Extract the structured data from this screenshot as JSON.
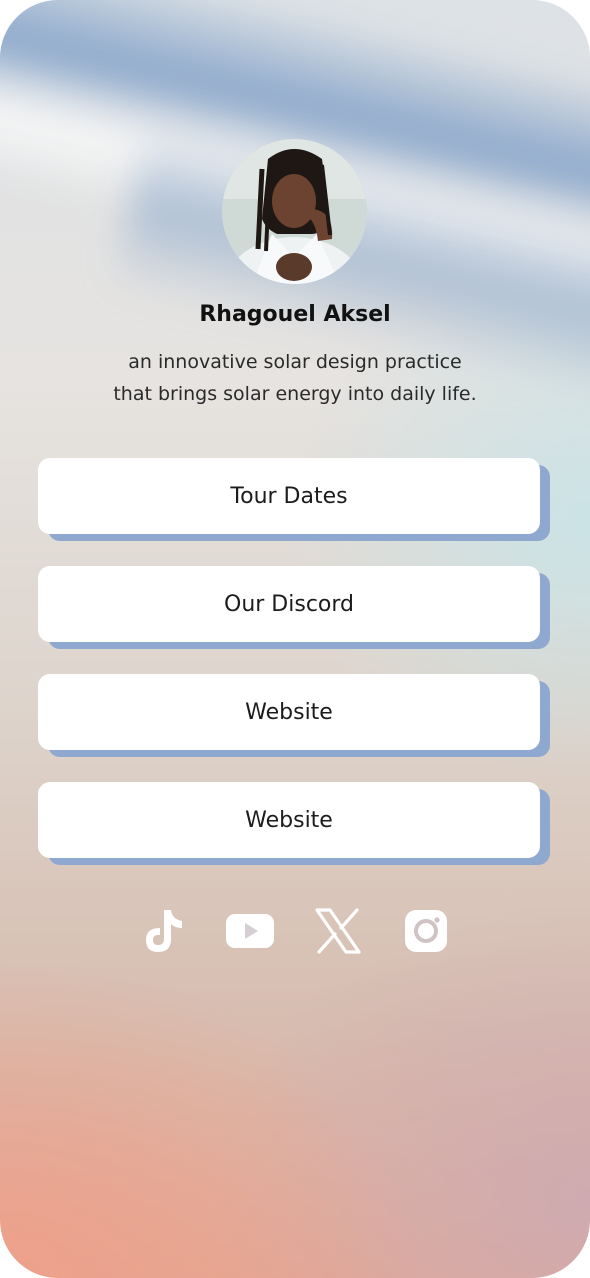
{
  "profile": {
    "name": "Rhagouel Aksel",
    "bio_line1": "an innovative solar design practice",
    "bio_line2": "that brings solar energy into daily life."
  },
  "links": [
    {
      "label": "Tour Dates"
    },
    {
      "label": "Our Discord"
    },
    {
      "label": "Website"
    },
    {
      "label": "Website"
    }
  ],
  "socials": [
    {
      "icon": "tiktok-icon"
    },
    {
      "icon": "youtube-icon"
    },
    {
      "icon": "x-icon"
    },
    {
      "icon": "instagram-icon"
    }
  ],
  "colors": {
    "button_shadow": "#8ea8cf",
    "button_bg": "#ffffff",
    "icon_color": "#ffffff"
  }
}
